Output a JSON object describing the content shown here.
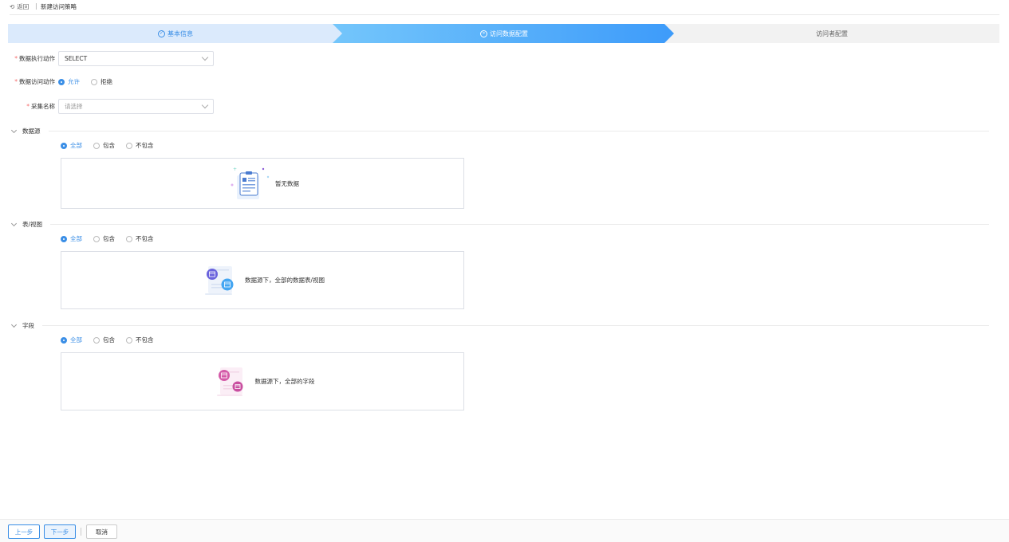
{
  "header": {
    "back_label": "返回",
    "separator": "|",
    "title": "新建访问策略"
  },
  "steps": [
    {
      "label": "基本信息"
    },
    {
      "label": "访问数据配置"
    },
    {
      "label": "访问者配置"
    }
  ],
  "form": {
    "exec_action": {
      "label": "数据执行动作",
      "value": "SELECT"
    },
    "access_action": {
      "label": "数据访问动作",
      "options": [
        "允许",
        "拒绝"
      ],
      "selected": "允许"
    },
    "collect_name": {
      "label": "采集名称",
      "placeholder": "请选择"
    }
  },
  "sections": [
    {
      "title": "数据源",
      "options": [
        "全部",
        "包含",
        "不包含"
      ],
      "selected": "全部",
      "empty_text": "暂无数据"
    },
    {
      "title": "表/视图",
      "options": [
        "全部",
        "包含",
        "不包含"
      ],
      "selected": "全部",
      "empty_text": "数据源下，全部的数据表/视图"
    },
    {
      "title": "字段",
      "options": [
        "全部",
        "包含",
        "不包含"
      ],
      "selected": "全部",
      "empty_text": "数据源下，全部的字段"
    }
  ],
  "footer": {
    "prev_label": "上一步",
    "next_label": "下一步",
    "cancel_label": "取消"
  },
  "colors": {
    "accent": "#3a8ee6",
    "required": "#f56c6c",
    "step_active": "#3d9bfa"
  }
}
